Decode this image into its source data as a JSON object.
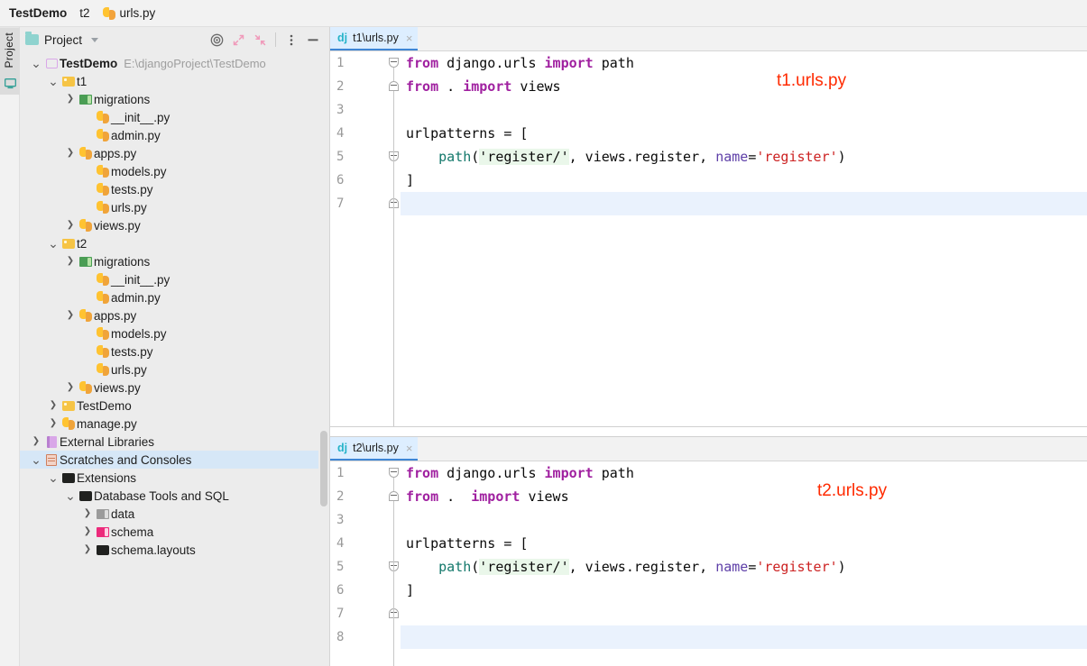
{
  "breadcrumb": {
    "items": [
      {
        "label": "TestDemo",
        "bold": true,
        "icon": "none"
      },
      {
        "label": "t2",
        "bold": false,
        "icon": "none"
      },
      {
        "label": "urls.py",
        "bold": false,
        "icon": "python-file-icon"
      }
    ]
  },
  "tool_strip": {
    "project_tab_label": "Project",
    "bottom_icon": "monitor-icon"
  },
  "project_toolbar": {
    "title": "Project",
    "dropdown_icon": "chevron-down-icon",
    "buttons": [
      {
        "name": "locate-in-tree-icon",
        "glyph": "target"
      },
      {
        "name": "expand-all-icon",
        "glyph": "expand"
      },
      {
        "name": "collapse-all-icon",
        "glyph": "collapse"
      },
      {
        "name": "options-menu-icon",
        "glyph": "kebab"
      },
      {
        "name": "hide-panel-icon",
        "glyph": "minus"
      }
    ]
  },
  "tree": {
    "rows": [
      {
        "indent": 0,
        "arrow": "down",
        "icon": "project-icon",
        "label": "TestDemo",
        "bold": true,
        "path": "E:\\djangoProject\\TestDemo",
        "selected": false
      },
      {
        "indent": 1,
        "arrow": "down",
        "icon": "folder-yellow-icon",
        "label": "t1",
        "bold": false,
        "path": "",
        "selected": false
      },
      {
        "indent": 2,
        "arrow": "right",
        "icon": "folder-green-icon",
        "label": "migrations",
        "bold": false,
        "path": "",
        "selected": false
      },
      {
        "indent": 3,
        "arrow": "none",
        "icon": "python-file-icon",
        "label": "__init__.py",
        "bold": false,
        "path": "",
        "selected": false
      },
      {
        "indent": 3,
        "arrow": "none",
        "icon": "python-file-icon",
        "label": "admin.py",
        "bold": false,
        "path": "",
        "selected": false
      },
      {
        "indent": 2,
        "arrow": "right",
        "icon": "python-file-icon",
        "label": "apps.py",
        "bold": false,
        "path": "",
        "selected": false
      },
      {
        "indent": 3,
        "arrow": "none",
        "icon": "python-file-icon",
        "label": "models.py",
        "bold": false,
        "path": "",
        "selected": false
      },
      {
        "indent": 3,
        "arrow": "none",
        "icon": "python-file-icon",
        "label": "tests.py",
        "bold": false,
        "path": "",
        "selected": false
      },
      {
        "indent": 3,
        "arrow": "none",
        "icon": "python-file-icon",
        "label": "urls.py",
        "bold": false,
        "path": "",
        "selected": false
      },
      {
        "indent": 2,
        "arrow": "right",
        "icon": "python-file-icon",
        "label": "views.py",
        "bold": false,
        "path": "",
        "selected": false
      },
      {
        "indent": 1,
        "arrow": "down",
        "icon": "folder-yellow-icon",
        "label": "t2",
        "bold": false,
        "path": "",
        "selected": false
      },
      {
        "indent": 2,
        "arrow": "right",
        "icon": "folder-green-icon",
        "label": "migrations",
        "bold": false,
        "path": "",
        "selected": false
      },
      {
        "indent": 3,
        "arrow": "none",
        "icon": "python-file-icon",
        "label": "__init__.py",
        "bold": false,
        "path": "",
        "selected": false
      },
      {
        "indent": 3,
        "arrow": "none",
        "icon": "python-file-icon",
        "label": "admin.py",
        "bold": false,
        "path": "",
        "selected": false
      },
      {
        "indent": 2,
        "arrow": "right",
        "icon": "python-file-icon",
        "label": "apps.py",
        "bold": false,
        "path": "",
        "selected": false
      },
      {
        "indent": 3,
        "arrow": "none",
        "icon": "python-file-icon",
        "label": "models.py",
        "bold": false,
        "path": "",
        "selected": false
      },
      {
        "indent": 3,
        "arrow": "none",
        "icon": "python-file-icon",
        "label": "tests.py",
        "bold": false,
        "path": "",
        "selected": false
      },
      {
        "indent": 3,
        "arrow": "none",
        "icon": "python-file-icon",
        "label": "urls.py",
        "bold": false,
        "path": "",
        "selected": false
      },
      {
        "indent": 2,
        "arrow": "right",
        "icon": "python-file-icon",
        "label": "views.py",
        "bold": false,
        "path": "",
        "selected": false
      },
      {
        "indent": 1,
        "arrow": "right",
        "icon": "folder-yellow-icon",
        "label": "TestDemo",
        "bold": false,
        "path": "",
        "selected": false
      },
      {
        "indent": 1,
        "arrow": "right",
        "icon": "python-file-icon",
        "label": "manage.py",
        "bold": false,
        "path": "",
        "selected": false
      },
      {
        "indent": 0,
        "arrow": "right",
        "icon": "library-icon",
        "label": "External Libraries",
        "bold": false,
        "path": "",
        "selected": false
      },
      {
        "indent": 0,
        "arrow": "down",
        "icon": "scratch-icon",
        "label": "Scratches and Consoles",
        "bold": false,
        "path": "",
        "selected": true
      },
      {
        "indent": 1,
        "arrow": "down",
        "icon": "folder-black-icon",
        "label": "Extensions",
        "bold": false,
        "path": "",
        "selected": false
      },
      {
        "indent": 2,
        "arrow": "down",
        "icon": "folder-black-icon",
        "label": "Database Tools and SQL",
        "bold": false,
        "path": "",
        "selected": false
      },
      {
        "indent": 3,
        "arrow": "right",
        "icon": "folder-gray-icon",
        "label": "data",
        "bold": false,
        "path": "",
        "selected": false
      },
      {
        "indent": 3,
        "arrow": "right",
        "icon": "folder-pink-icon",
        "label": "schema",
        "bold": false,
        "path": "",
        "selected": false
      },
      {
        "indent": 3,
        "arrow": "right",
        "icon": "folder-black-icon",
        "label": "schema.layouts",
        "bold": false,
        "path": "",
        "selected": false
      }
    ]
  },
  "editors": [
    {
      "tab": {
        "icon_label": "dj",
        "title": "t1\\urls.py",
        "close": "×"
      },
      "annotation": "t1.urls.py",
      "lines": [
        {
          "num": "1",
          "tokens": [
            {
              "t": "from",
              "c": "kw"
            },
            {
              "t": " django.urls ",
              "c": "plain"
            },
            {
              "t": "import",
              "c": "kw"
            },
            {
              "t": " path",
              "c": "plain"
            }
          ],
          "current": false
        },
        {
          "num": "2",
          "tokens": [
            {
              "t": "from",
              "c": "kw"
            },
            {
              "t": " . ",
              "c": "plain"
            },
            {
              "t": "import",
              "c": "kw"
            },
            {
              "t": " views",
              "c": "plain"
            }
          ],
          "current": false
        },
        {
          "num": "3",
          "tokens": [],
          "current": false
        },
        {
          "num": "4",
          "tokens": [
            {
              "t": "urlpatterns = [",
              "c": "plain"
            }
          ],
          "current": false
        },
        {
          "num": "5",
          "tokens": [
            {
              "t": "    ",
              "c": "plain"
            },
            {
              "t": "path",
              "c": "fn"
            },
            {
              "t": "(",
              "c": "plain"
            },
            {
              "t": "'register/'",
              "c": "str"
            },
            {
              "t": ", views.register, ",
              "c": "plain"
            },
            {
              "t": "name",
              "c": "kwarg"
            },
            {
              "t": "=",
              "c": "plain"
            },
            {
              "t": "'register'",
              "c": "strred"
            },
            {
              "t": ")",
              "c": "plain"
            }
          ],
          "current": false
        },
        {
          "num": "6",
          "tokens": [
            {
              "t": "]",
              "c": "plain"
            }
          ],
          "current": false
        },
        {
          "num": "7",
          "tokens": [],
          "current": true
        }
      ]
    },
    {
      "tab": {
        "icon_label": "dj",
        "title": "t2\\urls.py",
        "close": "×"
      },
      "annotation": "t2.urls.py",
      "lines": [
        {
          "num": "1",
          "tokens": [
            {
              "t": "from",
              "c": "kw"
            },
            {
              "t": " django.urls ",
              "c": "plain"
            },
            {
              "t": "import",
              "c": "kw"
            },
            {
              "t": " path",
              "c": "plain"
            }
          ],
          "current": false
        },
        {
          "num": "2",
          "tokens": [
            {
              "t": "from",
              "c": "kw"
            },
            {
              "t": " .  ",
              "c": "plain"
            },
            {
              "t": "import",
              "c": "kw"
            },
            {
              "t": " views",
              "c": "plain"
            }
          ],
          "current": false
        },
        {
          "num": "3",
          "tokens": [],
          "current": false
        },
        {
          "num": "4",
          "tokens": [
            {
              "t": "urlpatterns = [",
              "c": "plain"
            }
          ],
          "current": false
        },
        {
          "num": "5",
          "tokens": [
            {
              "t": "    ",
              "c": "plain"
            },
            {
              "t": "path",
              "c": "fn"
            },
            {
              "t": "(",
              "c": "plain"
            },
            {
              "t": "'register/'",
              "c": "str"
            },
            {
              "t": ", views.register, ",
              "c": "plain"
            },
            {
              "t": "name",
              "c": "kwarg"
            },
            {
              "t": "=",
              "c": "plain"
            },
            {
              "t": "'register'",
              "c": "strred"
            },
            {
              "t": ")",
              "c": "plain"
            }
          ],
          "current": false
        },
        {
          "num": "6",
          "tokens": [
            {
              "t": "]",
              "c": "plain"
            }
          ],
          "current": false
        },
        {
          "num": "7",
          "tokens": [],
          "current": false
        },
        {
          "num": "8",
          "tokens": [],
          "current": true
        }
      ]
    }
  ],
  "colors": {
    "keyword": "#a020a0",
    "function": "#13786b",
    "string_highlight": "#eaf7ea",
    "string_red": "#cc2222",
    "kwarg": "#5e3fa8",
    "annotation_red": "#ff2a00",
    "tab_active_bg": "#ddeeff",
    "tab_underline": "#3e86d6",
    "selection_bg": "#d6e7f7"
  }
}
